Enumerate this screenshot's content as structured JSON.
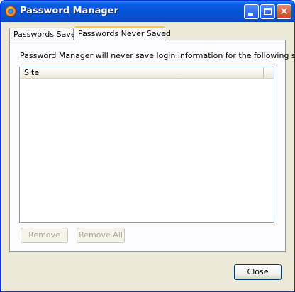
{
  "window": {
    "title": "Password Manager",
    "buttons": [
      "minimize",
      "maximize",
      "close"
    ]
  },
  "tabs": [
    {
      "label": "Passwords Saved",
      "active": false
    },
    {
      "label": "Passwords Never Saved",
      "active": true
    }
  ],
  "panel": {
    "description": "Password Manager will never save login information for the following sites:",
    "columns": [
      "Site"
    ],
    "rows": []
  },
  "actions": {
    "remove": "Remove",
    "remove_all": "Remove All",
    "close": "Close"
  },
  "colors": {
    "titlebar": "#0454d8",
    "active_tab_accent": "#ffc83c",
    "window_bg": "#ece9d8"
  }
}
